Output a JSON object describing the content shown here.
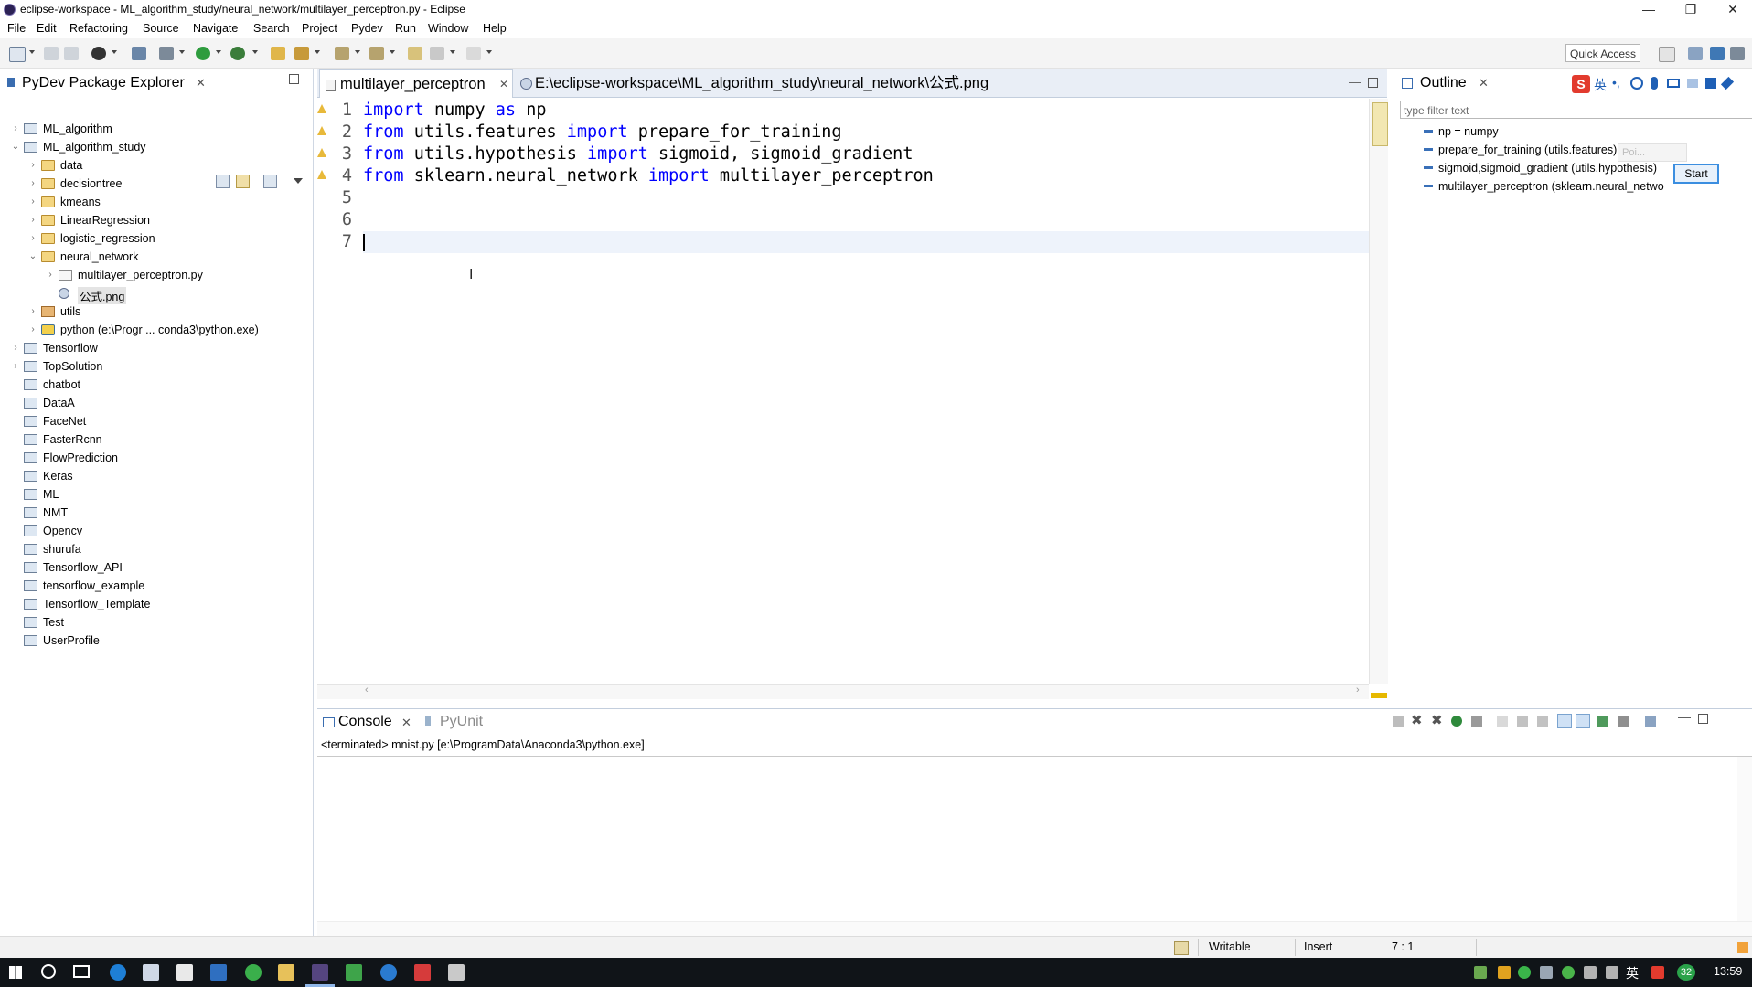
{
  "window": {
    "title": "eclipse-workspace - ML_algorithm_study/neural_network/multilayer_perceptron.py - Eclipse",
    "controls": [
      "—",
      "❐",
      "✕"
    ]
  },
  "menu": [
    "File",
    "Edit",
    "Refactoring",
    "Source",
    "Navigate",
    "Search",
    "Project",
    "Pydev",
    "Run",
    "Window",
    "Help"
  ],
  "toolbar": {
    "quick_access": "Quick Access"
  },
  "explorer": {
    "title": "PyDev Package Explorer",
    "items": [
      {
        "label": "ML_algorithm",
        "type": "proj",
        "twisty": "›"
      },
      {
        "label": "ML_algorithm_study",
        "type": "proj",
        "twisty": "⌄"
      },
      {
        "label": "data",
        "type": "folder",
        "twisty": "›"
      },
      {
        "label": "decisiontree",
        "type": "folder",
        "twisty": "›"
      },
      {
        "label": "kmeans",
        "type": "folder",
        "twisty": "›"
      },
      {
        "label": "LinearRegression",
        "type": "folder",
        "twisty": "›"
      },
      {
        "label": "logistic_regression",
        "type": "folder",
        "twisty": "›"
      },
      {
        "label": "neural_network",
        "type": "folder",
        "twisty": "⌄"
      },
      {
        "label": "multilayer_perceptron.py",
        "type": "pyfile",
        "twisty": "›"
      },
      {
        "label": "公式.png",
        "type": "png",
        "twisty": ""
      },
      {
        "label": "utils",
        "type": "pkg",
        "twisty": "›"
      },
      {
        "label": "python  (e:\\Progr ... conda3\\python.exe)",
        "type": "interp",
        "twisty": "›"
      },
      {
        "label": "Tensorflow",
        "type": "proj",
        "twisty": "›"
      },
      {
        "label": "TopSolution",
        "type": "proj",
        "twisty": "›"
      },
      {
        "label": "chatbot",
        "type": "projclosed",
        "twisty": ""
      },
      {
        "label": "DataA",
        "type": "projclosed",
        "twisty": ""
      },
      {
        "label": "FaceNet",
        "type": "projclosed",
        "twisty": ""
      },
      {
        "label": "FasterRcnn",
        "type": "projclosed",
        "twisty": ""
      },
      {
        "label": "FlowPrediction",
        "type": "projclosed",
        "twisty": ""
      },
      {
        "label": "Keras",
        "type": "projclosed",
        "twisty": ""
      },
      {
        "label": "ML",
        "type": "projclosed",
        "twisty": ""
      },
      {
        "label": "NMT",
        "type": "projclosed",
        "twisty": ""
      },
      {
        "label": "Opencv",
        "type": "projclosed",
        "twisty": ""
      },
      {
        "label": "shurufa",
        "type": "projclosed",
        "twisty": ""
      },
      {
        "label": "Tensorflow_API",
        "type": "projclosed",
        "twisty": ""
      },
      {
        "label": "tensorflow_example",
        "type": "projclosed",
        "twisty": ""
      },
      {
        "label": "Tensorflow_Template",
        "type": "projclosed",
        "twisty": ""
      },
      {
        "label": "Test",
        "type": "projclosed",
        "twisty": ""
      },
      {
        "label": "UserProfile",
        "type": "projclosed",
        "twisty": ""
      }
    ]
  },
  "editor": {
    "tabs": [
      {
        "label": "multilayer_perceptron",
        "close": "✕"
      },
      {
        "label": "E:\\eclipse-workspace\\ML_algorithm_study\\neural_network\\公式.png"
      }
    ],
    "lines": [
      {
        "num": "1",
        "warn": true,
        "tokens": [
          [
            "kw",
            "import"
          ],
          [
            "tx",
            " numpy "
          ],
          [
            "kw",
            "as"
          ],
          [
            "tx",
            " np"
          ]
        ]
      },
      {
        "num": "2",
        "warn": true,
        "tokens": [
          [
            "kw",
            "from"
          ],
          [
            "tx",
            " utils.features "
          ],
          [
            "kw",
            "import"
          ],
          [
            "tx",
            " prepare_for_training"
          ]
        ]
      },
      {
        "num": "3",
        "warn": true,
        "tokens": [
          [
            "kw",
            "from"
          ],
          [
            "tx",
            " utils.hypothesis "
          ],
          [
            "kw",
            "import"
          ],
          [
            "tx",
            " sigmoid, sigmoid_gradient"
          ]
        ]
      },
      {
        "num": "4",
        "warn": true,
        "tokens": [
          [
            "kw",
            "from"
          ],
          [
            "tx",
            " sklearn.neural_network "
          ],
          [
            "kw",
            "import"
          ],
          [
            "tx",
            " multilayer_perceptron"
          ]
        ]
      },
      {
        "num": "5",
        "warn": false,
        "tokens": []
      },
      {
        "num": "6",
        "warn": false,
        "tokens": []
      },
      {
        "num": "7",
        "warn": false,
        "tokens": []
      }
    ]
  },
  "outline": {
    "title": "Outline",
    "filter_placeholder": "type filter text",
    "items": [
      "np = numpy",
      "prepare_for_training (utils.features)",
      "sigmoid,sigmoid_gradient (utils.hypothesis)",
      "multilayer_perceptron (sklearn.neural_netwo"
    ],
    "popup_text": "Poi...",
    "start_button": "Start"
  },
  "console": {
    "tabs": [
      "Console",
      "PyUnit"
    ],
    "status_line": "<terminated> mnist.py [e:\\ProgramData\\Anaconda3\\python.exe]"
  },
  "statusbar": {
    "writable": "Writable",
    "mode": "Insert",
    "position": "7 : 1"
  },
  "taskbar": {
    "clock": "13:59",
    "tray_badge": "32",
    "ime": "英"
  },
  "colors": {
    "keyword": "#0000ff",
    "warning": "#e8b93a",
    "taskbar": "#101418"
  }
}
